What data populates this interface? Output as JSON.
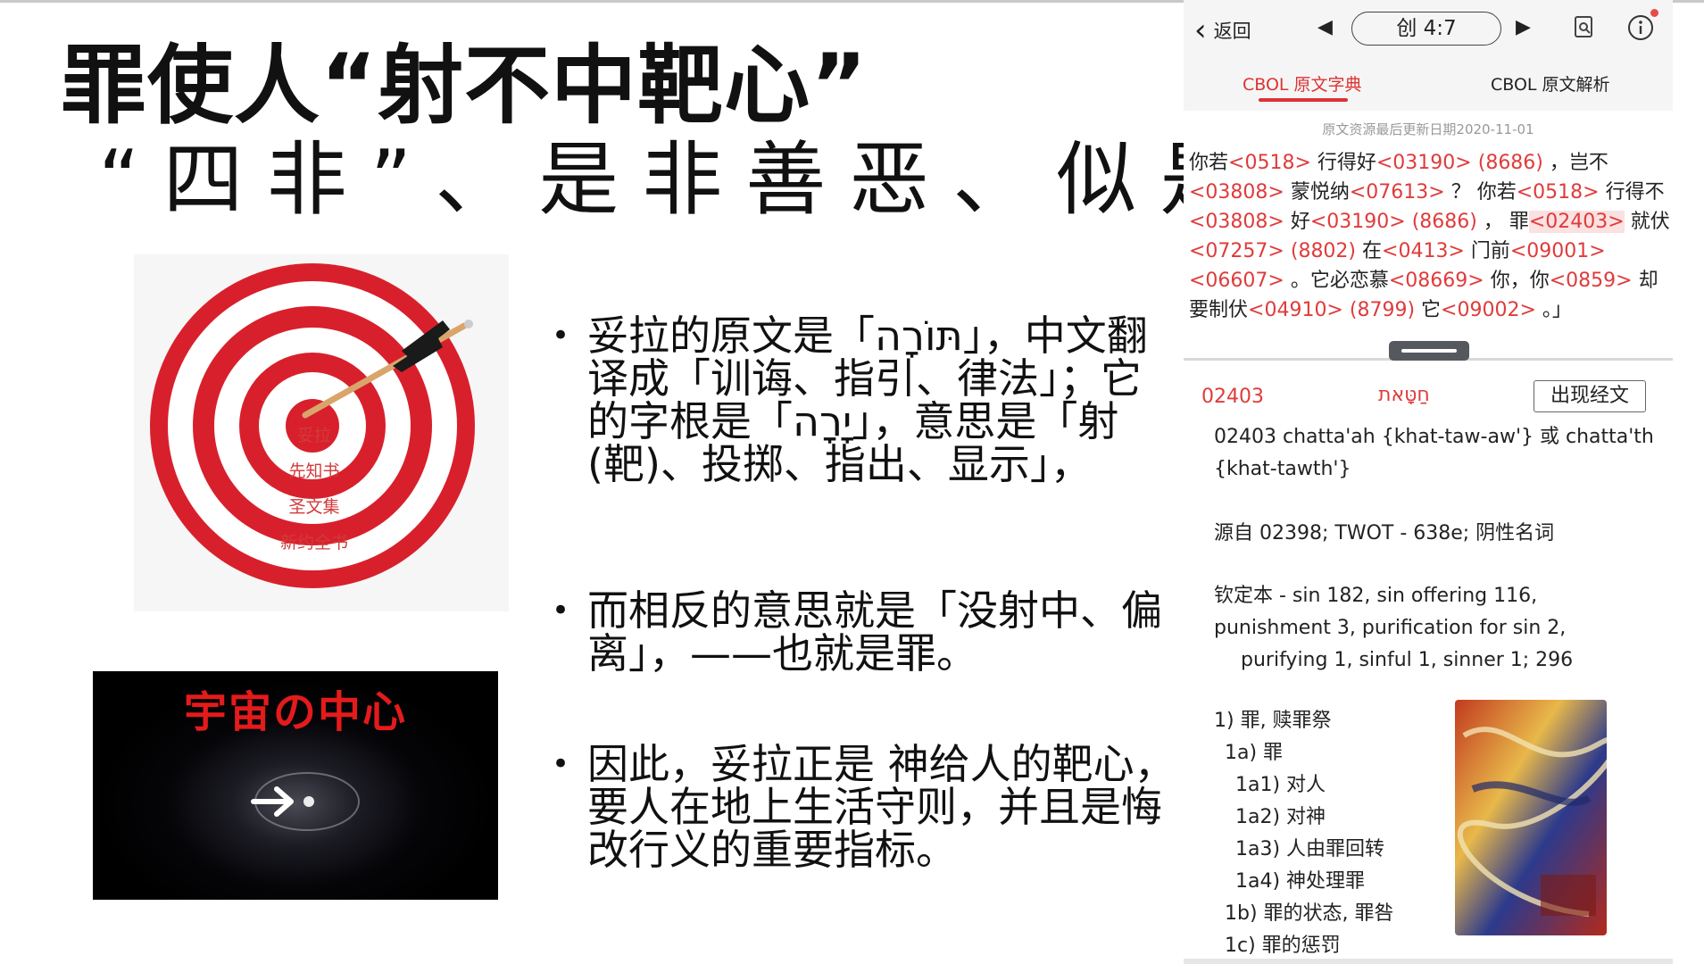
{
  "slide": {
    "title": "罪使人“射不中靶心”",
    "subtitle": "“四非”、是非善恶、似是而非",
    "target_labels": [
      "妥拉",
      "先知书",
      "圣文集",
      "新约全书"
    ],
    "galaxy_caption": "宇宙の中心",
    "bullets": [
      "妥拉的原文是「תּוֹרָה」，中文翻译成「训诲、指引、律法」；它的字根是「יָרָה」，意思是「射(靶)、投掷、指出、显示」，",
      "而相反的意思就是「没射中、偏离」，——也就是罪。",
      "因此，妥拉正是 神给人的靶心，要人在地上生活守则，并且是悔改行义的重要指标。"
    ]
  },
  "phone": {
    "back_label": "返回",
    "reference": "创 4:7",
    "tabs": [
      "CBOL 原文字典",
      "CBOL 原文解析"
    ],
    "updated": "原文资源最后更新日期2020-11-01",
    "verse": [
      {
        "t": "你若"
      },
      {
        "t": "<0518>",
        "s": 1
      },
      {
        "t": " 行得好"
      },
      {
        "t": "<03190>",
        "s": 1
      },
      {
        "t": " "
      },
      {
        "t": "(8686)",
        "s": 1
      },
      {
        "t": " ，岂不 "
      },
      {
        "t": "<03808>",
        "s": 1
      },
      {
        "t": " 蒙悦纳"
      },
      {
        "t": "<07613>",
        "s": 1
      },
      {
        "t": " ？ 你若"
      },
      {
        "t": "<0518>",
        "s": 1
      },
      {
        "t": " 行得不 "
      },
      {
        "t": "<03808>",
        "s": 1
      },
      {
        "t": " 好"
      },
      {
        "t": "<03190>",
        "s": 1
      },
      {
        "t": " "
      },
      {
        "t": "(8686)",
        "s": 1
      },
      {
        "t": " ， 罪"
      },
      {
        "t": "<02403>",
        "s": 1,
        "h": 1
      },
      {
        "t": " 就伏"
      },
      {
        "t": "<07257>",
        "s": 1
      },
      {
        "t": " "
      },
      {
        "t": "(8802)",
        "s": 1
      },
      {
        "t": " 在"
      },
      {
        "t": "<0413>",
        "s": 1
      },
      {
        "t": " 门前"
      },
      {
        "t": "<09001>",
        "s": 1
      },
      {
        "t": " "
      },
      {
        "t": "<06607>",
        "s": 1
      },
      {
        "t": " 。它必恋慕"
      },
      {
        "t": "<08669>",
        "s": 1
      },
      {
        "t": " 你，你"
      },
      {
        "t": "<0859>",
        "s": 1
      },
      {
        "t": " 却要制伏"
      },
      {
        "t": "<04910>",
        "s": 1
      },
      {
        "t": " "
      },
      {
        "t": "(8799)",
        "s": 1
      },
      {
        "t": " 它"
      },
      {
        "t": "<09002>",
        "s": 1
      },
      {
        "t": " 。」"
      }
    ],
    "entry": {
      "number": "02403",
      "hebrew": "חַטָּאת",
      "occurrences_button": "出现经文",
      "translit_1": "02403 chatta'ah {khat-taw-aw'} 或 chatta'th",
      "translit_2": "{khat-tawth'}",
      "source": "源自 02398; TWOT - 638e; 阴性名词",
      "kjv_1": "钦定本 - sin 182, sin offering 116,",
      "kjv_2": "punishment 3, purification for sin 2,",
      "kjv_3": "purifying 1, sinful 1, sinner 1; 296",
      "senses": [
        {
          "level": 1,
          "text": "1) 罪, 赎罪祭"
        },
        {
          "level": 2,
          "text": "1a) 罪"
        },
        {
          "level": 3,
          "text": "1a1) 对人"
        },
        {
          "level": 3,
          "text": "1a2) 对神"
        },
        {
          "level": 3,
          "text": "1a3) 人由罪回转"
        },
        {
          "level": 3,
          "text": "1a4) 神处理罪"
        },
        {
          "level": 2,
          "text": "1b) 罪的状态, 罪咎"
        },
        {
          "level": 2,
          "text": "1c) 罪的惩罚"
        }
      ]
    }
  }
}
